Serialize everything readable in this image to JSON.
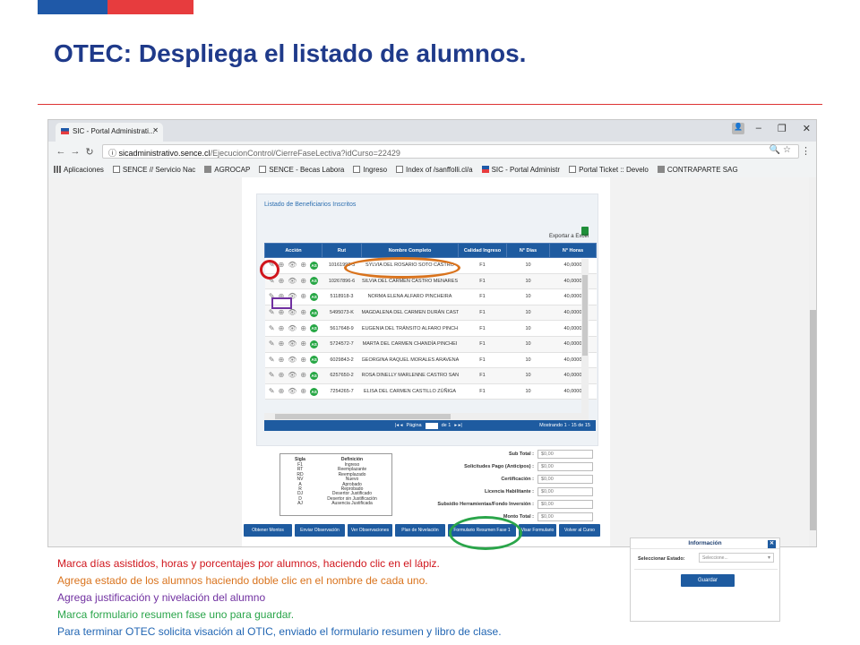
{
  "slide": {
    "title": "OTEC: Despliega el listado de alumnos."
  },
  "browser": {
    "tab_title": "SIC - Portal Administrati...",
    "url_host": "sicadministrativo.sence.cl",
    "url_path": "/EjecucionControl/CierreFaseLectiva?idCurso=22429",
    "bookmarks": [
      {
        "label": "Aplicaciones",
        "icon": "grid-icon"
      },
      {
        "label": "SENCE // Servicio Nac",
        "icon": "doc-icon"
      },
      {
        "label": "AGROCAP",
        "icon": "app-icon"
      },
      {
        "label": "SENCE - Becas Labora",
        "icon": "doc-icon"
      },
      {
        "label": "Ingreso",
        "icon": "doc-icon"
      },
      {
        "label": "Index of /sanffolli.cl/a",
        "icon": "doc-icon"
      },
      {
        "label": "SIC - Portal Administr",
        "icon": "flag-icon"
      },
      {
        "label": "Portal Ticket :: Develo",
        "icon": "doc-icon"
      },
      {
        "label": "CONTRAPARTE SAG",
        "icon": "app-icon"
      }
    ]
  },
  "page": {
    "section_title": "Listado de Beneficiarios Inscritos",
    "export_label": "Exportar a Excel",
    "columns": [
      "Acción",
      "Rut",
      "Nombre Completo",
      "Calidad Ingreso",
      "N° Días",
      "N° Horas"
    ],
    "rows": [
      {
        "rut": "10161992-3",
        "nombre": "SYLVIA DEL ROSARIO SOTO CASTRO",
        "calidad": "F1",
        "dias": "10",
        "horas": "40,0000"
      },
      {
        "rut": "10267896-6",
        "nombre": "SILVIA DEL CARMEN CASTRO MENARES",
        "calidad": "F1",
        "dias": "10",
        "horas": "40,0000"
      },
      {
        "rut": "5118918-3",
        "nombre": "NORMA ELENA ALFARO PINCHEIRA",
        "calidad": "F1",
        "dias": "10",
        "horas": "40,0000"
      },
      {
        "rut": "5495073-K",
        "nombre": "MAGDALENA DEL CARMEN DURÁN CAST",
        "calidad": "F1",
        "dias": "10",
        "horas": "40,0000"
      },
      {
        "rut": "5617648-9",
        "nombre": "EUGENIA DEL TRÁNSITO ALFARO PINCH",
        "calidad": "F1",
        "dias": "10",
        "horas": "40,0000"
      },
      {
        "rut": "5724572-7",
        "nombre": "MARTA DEL CARMEN CHANDÍA PINCHEI",
        "calidad": "F1",
        "dias": "10",
        "horas": "40,0000"
      },
      {
        "rut": "6029843-2",
        "nombre": "GEORGINA RAQUEL MORALES ARAVENA",
        "calidad": "F1",
        "dias": "10",
        "horas": "40,0000"
      },
      {
        "rut": "6257650-2",
        "nombre": "ROSA DINELLY MARLENNE CASTRO SAN",
        "calidad": "F1",
        "dias": "10",
        "horas": "40,0000"
      },
      {
        "rut": "7254265-7",
        "nombre": "ELISA DEL CARMEN CASTILLO ZÚÑIGA",
        "calidad": "F1",
        "dias": "10",
        "horas": "40,0000"
      }
    ],
    "pager": {
      "page_label": "Página",
      "page_value": "1",
      "of_label": "de 1",
      "showing": "Mostrando 1 - 15 de 15"
    },
    "legend": {
      "header_sigla": "Sigla",
      "header_def": "Definición",
      "items": [
        {
          "sigla": "F1",
          "def": "Ingreso"
        },
        {
          "sigla": "RT",
          "def": "Reemplazante"
        },
        {
          "sigla": "RD",
          "def": "Reemplazado"
        },
        {
          "sigla": "NV",
          "def": "Nuevo"
        },
        {
          "sigla": "A",
          "def": "Aprobado"
        },
        {
          "sigla": "R",
          "def": "Reprobado"
        },
        {
          "sigla": "DJ",
          "def": "Desertor Justificado"
        },
        {
          "sigla": "D",
          "def": "Desertor sin Justificación"
        },
        {
          "sigla": "AJ",
          "def": "Ausencia Justificada"
        }
      ]
    },
    "totals": [
      {
        "label": "Sub Total :",
        "value": "$0,00"
      },
      {
        "label": "Solicitudes Pago (Anticipos) :",
        "value": "$0,00"
      },
      {
        "label": "Certificación :",
        "value": "$0,00"
      },
      {
        "label": "Licencia Habilitante :",
        "value": "$0,00"
      },
      {
        "label": "Subsidio Herramientas/Fondo Inversión :",
        "value": "$0,00"
      },
      {
        "label": "Monto Total :",
        "value": "$0,00"
      }
    ],
    "buttons": [
      "Obtener Montos",
      "Enviar Observación",
      "Ver Observaciones",
      "Plan de Nivelación",
      "Formulario Resumen Fase 1",
      "Visar Formulario",
      "Volver al Curso"
    ]
  },
  "instructions": [
    {
      "text": "Marca días asistidos, horas y porcentajes por alumnos, haciendo clic en el lápiz.",
      "color": "#d0161d"
    },
    {
      "text": "Agrega estado de los alumnos haciendo doble clic en el nombre de cada uno.",
      "color": "#d9731d"
    },
    {
      "text": "Agrega justificación y nivelación del alumno",
      "color": "#7030a0"
    },
    {
      "text": "Marca formulario resumen fase uno para guardar.",
      "color": "#2aa54a"
    },
    {
      "text": "Para terminar OTEC solicita visación al OTIC, enviado el formulario resumen y libro de clase.",
      "color": "#2266b3"
    }
  ],
  "info_dialog": {
    "title": "Información",
    "estado_label": "Seleccionar Estado:",
    "estado_placeholder": "Seleccione...",
    "save_label": "Guardar"
  },
  "colors": {
    "title": "#1f3a8a",
    "brand_blue": "#1f59a8",
    "brand_red": "#e73c3e",
    "table_header": "#1e5ba0"
  }
}
